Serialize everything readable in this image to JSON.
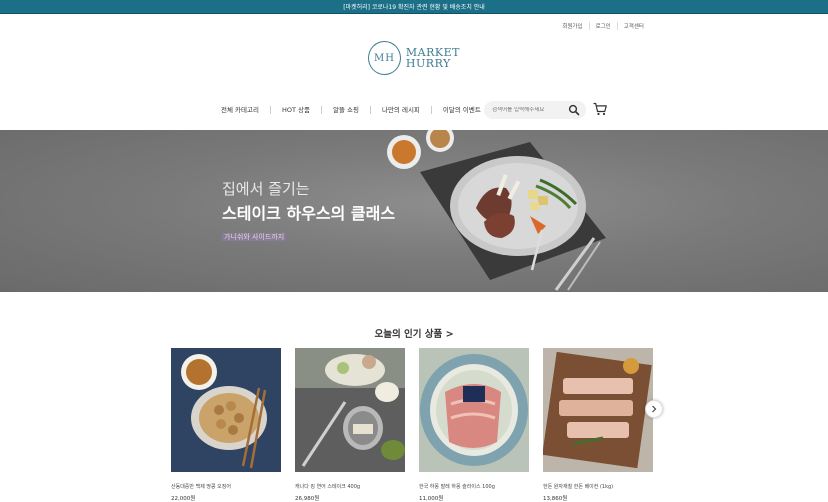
{
  "top_banner": {
    "text": "[마켓허리] 코로나19 확진자 관련 현황 및 배송조치 안내"
  },
  "util_links": [
    "회원가입",
    "로그인",
    "고객센터"
  ],
  "logo": {
    "mark": "MH",
    "line1": "MARKET",
    "line2": "HURRY"
  },
  "nav": {
    "items": [
      "전체 카테고리",
      "HOT 상품",
      "알뜰 쇼핑",
      "나만의 레시피",
      "이달의 이벤트"
    ]
  },
  "search": {
    "placeholder": "검색어를 입력해주세요"
  },
  "hero": {
    "subtitle": "집에서 즐기는",
    "title": "스테이크 하우스의 클래스",
    "desc_prefix": "가니쉬와 사이드",
    "desc_highlight": "가니쉬와 사이드까지",
    "desc": "가니쉬와 사이드까지"
  },
  "section": {
    "title": "오늘의 인기 상품 >"
  },
  "products": [
    {
      "name": "산동대중반 백제 땅콩 오징어",
      "price": "22,000원"
    },
    {
      "name": "캐나다 킹 연어 스테이크 400g",
      "price": "26,980원"
    },
    {
      "name": "한국 하몽 발레 하몽 슬라이스 100g",
      "price": "11,000원"
    },
    {
      "name": "한돈 원자재칠 한돈 베이컨 (1kg)",
      "price": "13,860원"
    }
  ],
  "colors": {
    "topbar": "#1b6f86",
    "brand": "#3d7d92"
  }
}
